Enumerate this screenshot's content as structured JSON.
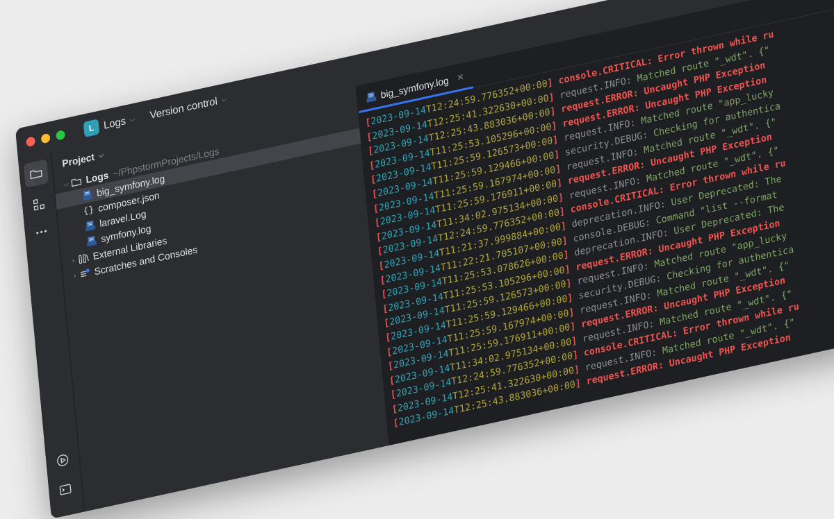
{
  "titlebar": {
    "project_badge": "L",
    "project_name": "Logs",
    "version_control": "Version control"
  },
  "project_panel": {
    "header": "Project",
    "root_name": "Logs",
    "root_path": "~/PhpstormProjects/Logs",
    "files": [
      "big_symfony.log",
      "composer.json",
      "laravel.Log",
      "symfony.log"
    ],
    "external_libraries": "External Libraries",
    "scratches": "Scratches and Consoles"
  },
  "editor": {
    "tab_label": "big_symfony.log",
    "lines": [
      {
        "date": "2023-09-14",
        "time": "T12:24:59.776352+00:00",
        "channel": "console.CRITICAL:",
        "message": "Error thrown while ru",
        "level": "error"
      },
      {
        "date": "2023-09-14",
        "time": "T12:25:41.322630+00:00",
        "channel": "request.INFO:",
        "message": "Matched route \"_wdt\". {\"",
        "level": "info"
      },
      {
        "date": "2023-09-14",
        "time": "T12:25:43.883036+00:00",
        "channel": "request.ERROR:",
        "message": "Uncaught PHP Exception",
        "level": "error"
      },
      {
        "date": "2023-09-14",
        "time": "T11:25:53.105296+00:00",
        "channel": "request.ERROR:",
        "message": "Uncaught PHP Exception",
        "level": "error"
      },
      {
        "date": "2023-09-14",
        "time": "T11:25:59.126573+00:00",
        "channel": "request.INFO:",
        "message": "Matched route \"app_lucky",
        "level": "info"
      },
      {
        "date": "2023-09-14",
        "time": "T11:25:59.129466+00:00",
        "channel": "security.DEBUG:",
        "message": "Checking for authentica",
        "level": "info"
      },
      {
        "date": "2023-09-14",
        "time": "T11:25:59.167974+00:00",
        "channel": "request.INFO:",
        "message": "Matched route \"_wdt\". {\"",
        "level": "info"
      },
      {
        "date": "2023-09-14",
        "time": "T11:25:59.176911+00:00",
        "channel": "request.ERROR:",
        "message": "Uncaught PHP Exception",
        "level": "error"
      },
      {
        "date": "2023-09-14",
        "time": "T11:34:02.975134+00:00",
        "channel": "request.INFO:",
        "message": "Matched route \"_wdt\". {\"",
        "level": "info"
      },
      {
        "date": "2023-09-14",
        "time": "T12:24:59.776352+00:00",
        "channel": "console.CRITICAL:",
        "message": "Error thrown while ru",
        "level": "error"
      },
      {
        "date": "2023-09-14",
        "time": "T11:21:37.999884+00:00",
        "channel": "deprecation.INFO:",
        "message": "User Deprecated: The",
        "level": "info"
      },
      {
        "date": "2023-09-14",
        "time": "T11:22:21.705107+00:00",
        "channel": "console.DEBUG:",
        "message": "Command \"list --format",
        "level": "info"
      },
      {
        "date": "2023-09-14",
        "time": "T11:25:53.078626+00:00",
        "channel": "deprecation.INFO:",
        "message": "User Deprecated: The",
        "level": "info"
      },
      {
        "date": "2023-09-14",
        "time": "T11:25:53.105296+00:00",
        "channel": "request.ERROR:",
        "message": "Uncaught PHP Exception",
        "level": "error"
      },
      {
        "date": "2023-09-14",
        "time": "T11:25:59.126573+00:00",
        "channel": "request.INFO:",
        "message": "Matched route \"app_lucky",
        "level": "info"
      },
      {
        "date": "2023-09-14",
        "time": "T11:25:59.129466+00:00",
        "channel": "security.DEBUG:",
        "message": "Checking for authentica",
        "level": "info"
      },
      {
        "date": "2023-09-14",
        "time": "T11:25:59.167974+00:00",
        "channel": "request.INFO:",
        "message": "Matched route \"_wdt\". {\"",
        "level": "info"
      },
      {
        "date": "2023-09-14",
        "time": "T11:25:59.176911+00:00",
        "channel": "request.ERROR:",
        "message": "Uncaught PHP Exception",
        "level": "error"
      },
      {
        "date": "2023-09-14",
        "time": "T11:34:02.975134+00:00",
        "channel": "request.INFO:",
        "message": "Matched route \"_wdt\". {\"",
        "level": "info"
      },
      {
        "date": "2023-09-14",
        "time": "T12:24:59.776352+00:00",
        "channel": "console.CRITICAL:",
        "message": "Error thrown while ru",
        "level": "error"
      },
      {
        "date": "2023-09-14",
        "time": "T12:25:41.322630+00:00",
        "channel": "request.INFO:",
        "message": "Matched route \"_wdt\". {\"",
        "level": "info"
      },
      {
        "date": "2023-09-14",
        "time": "T12:25:43.883036+00:00",
        "channel": "request.ERROR:",
        "message": "Uncaught PHP Exception",
        "level": "error"
      }
    ]
  },
  "colors": {
    "accent": "#3574f0",
    "bracket": "#e05252",
    "date": "#2fa3b5",
    "time": "#b0a438",
    "error": "#ef5350",
    "info_message": "#7fa463"
  }
}
